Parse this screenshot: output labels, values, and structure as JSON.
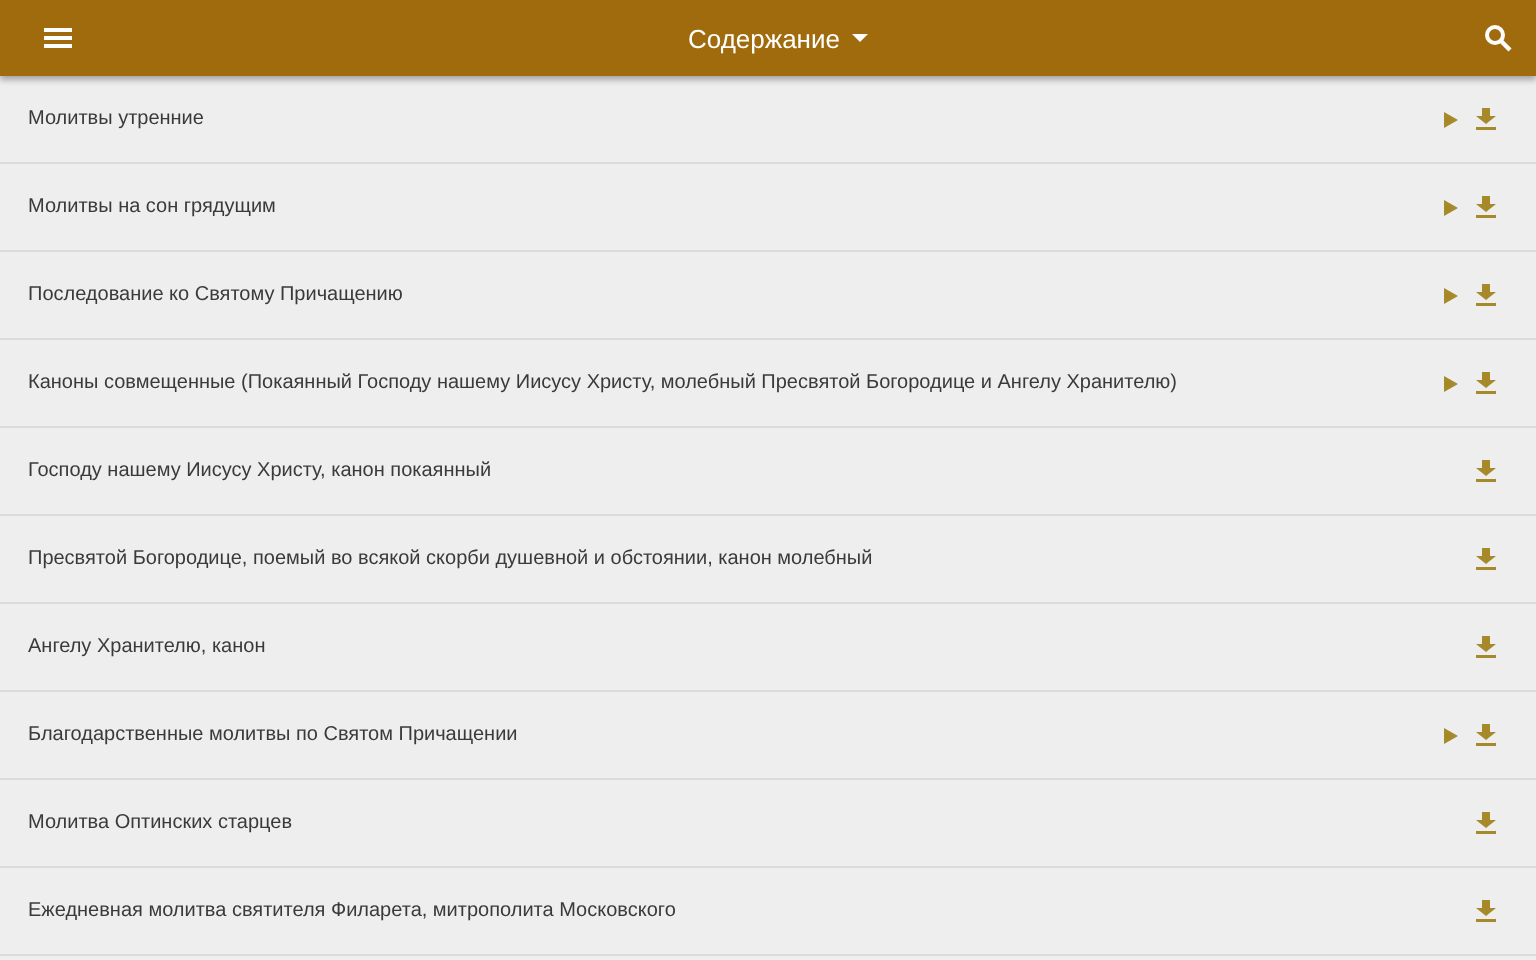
{
  "app_bar": {
    "title": "Содержание"
  },
  "items": [
    {
      "title": "Молитвы утренние",
      "has_audio": true
    },
    {
      "title": "Молитвы на сон грядущим",
      "has_audio": true
    },
    {
      "title": "Последование ко Святому Причащению",
      "has_audio": true
    },
    {
      "title": "Каноны совмещенные (Покаянный Господу нашему Иисусу Христу, молебный Пресвятой Богородице и Ангелу Хранителю)",
      "has_audio": true
    },
    {
      "title": "Господу нашему Иисусу Христу, канон покаянный",
      "has_audio": false
    },
    {
      "title": "Пресвятой Богородице, поемый во всякой скорби душевной и обстоянии, канон молебный",
      "has_audio": false
    },
    {
      "title": "Ангелу Хранителю, канон",
      "has_audio": false
    },
    {
      "title": "Благодарственные молитвы по Святом Причащении",
      "has_audio": true
    },
    {
      "title": "Молитва Оптинских старцев",
      "has_audio": false
    },
    {
      "title": "Ежедневная молитва святителя Филарета, митрополита Московского",
      "has_audio": false
    }
  ]
}
